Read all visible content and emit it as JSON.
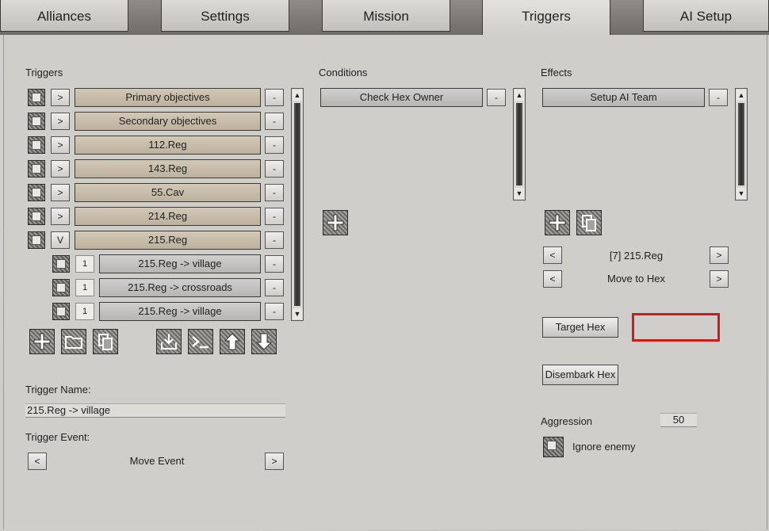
{
  "tabs": [
    "Alliances",
    "Settings",
    "Mission",
    "Triggers",
    "AI Setup"
  ],
  "triggers": {
    "heading": "Triggers",
    "rows": [
      {
        "expand": ">",
        "label": "Primary objectives",
        "remove": "-"
      },
      {
        "expand": ">",
        "label": "Secondary objectives",
        "remove": "-"
      },
      {
        "expand": ">",
        "label": "112.Reg",
        "remove": "-"
      },
      {
        "expand": ">",
        "label": "143.Reg",
        "remove": "-"
      },
      {
        "expand": ">",
        "label": "55.Cav",
        "remove": "-"
      },
      {
        "expand": ">",
        "label": "214.Reg",
        "remove": "-"
      },
      {
        "expand": "V",
        "label": "215.Reg",
        "remove": "-"
      }
    ],
    "subrows": [
      {
        "num": "1",
        "label": "215.Reg -> village",
        "remove": "-"
      },
      {
        "num": "1",
        "label": "215.Reg -> crossroads",
        "remove": "-"
      },
      {
        "num": "1",
        "label": "215.Reg -> village",
        "remove": "-"
      }
    ],
    "toolbar_icons": [
      "add-icon",
      "folder-icon",
      "copy-icon",
      "import-icon",
      "console-icon",
      "arrow-up-icon",
      "arrow-down-icon"
    ],
    "name_label": "Trigger Name:",
    "name_value": "215.Reg -> village",
    "event_label": "Trigger Event:",
    "event_prev": "<",
    "event_value": "Move Event",
    "event_next": ">"
  },
  "conditions": {
    "heading": "Conditions",
    "items": [
      {
        "label": "Check Hex Owner",
        "remove": "-"
      }
    ],
    "add_icon": "add-icon"
  },
  "effects": {
    "heading": "Effects",
    "items": [
      {
        "label": "Setup AI Team",
        "remove": "-"
      }
    ],
    "icons": [
      "add-icon",
      "copy-icon"
    ],
    "nav1_prev": "<",
    "nav1_value": "[7] 215.Reg",
    "nav1_next": ">",
    "nav2_prev": "<",
    "nav2_value": "Move to Hex",
    "nav2_next": ">",
    "target_hex": "Target Hex",
    "disembark_hex": "Disembark Hex",
    "aggression_label": "Aggression",
    "aggression_value": "50",
    "ignore_enemy": "Ignore enemy"
  },
  "colors": {
    "highlight": "#cc1c1c",
    "trigger_row": "#c9bda8"
  }
}
